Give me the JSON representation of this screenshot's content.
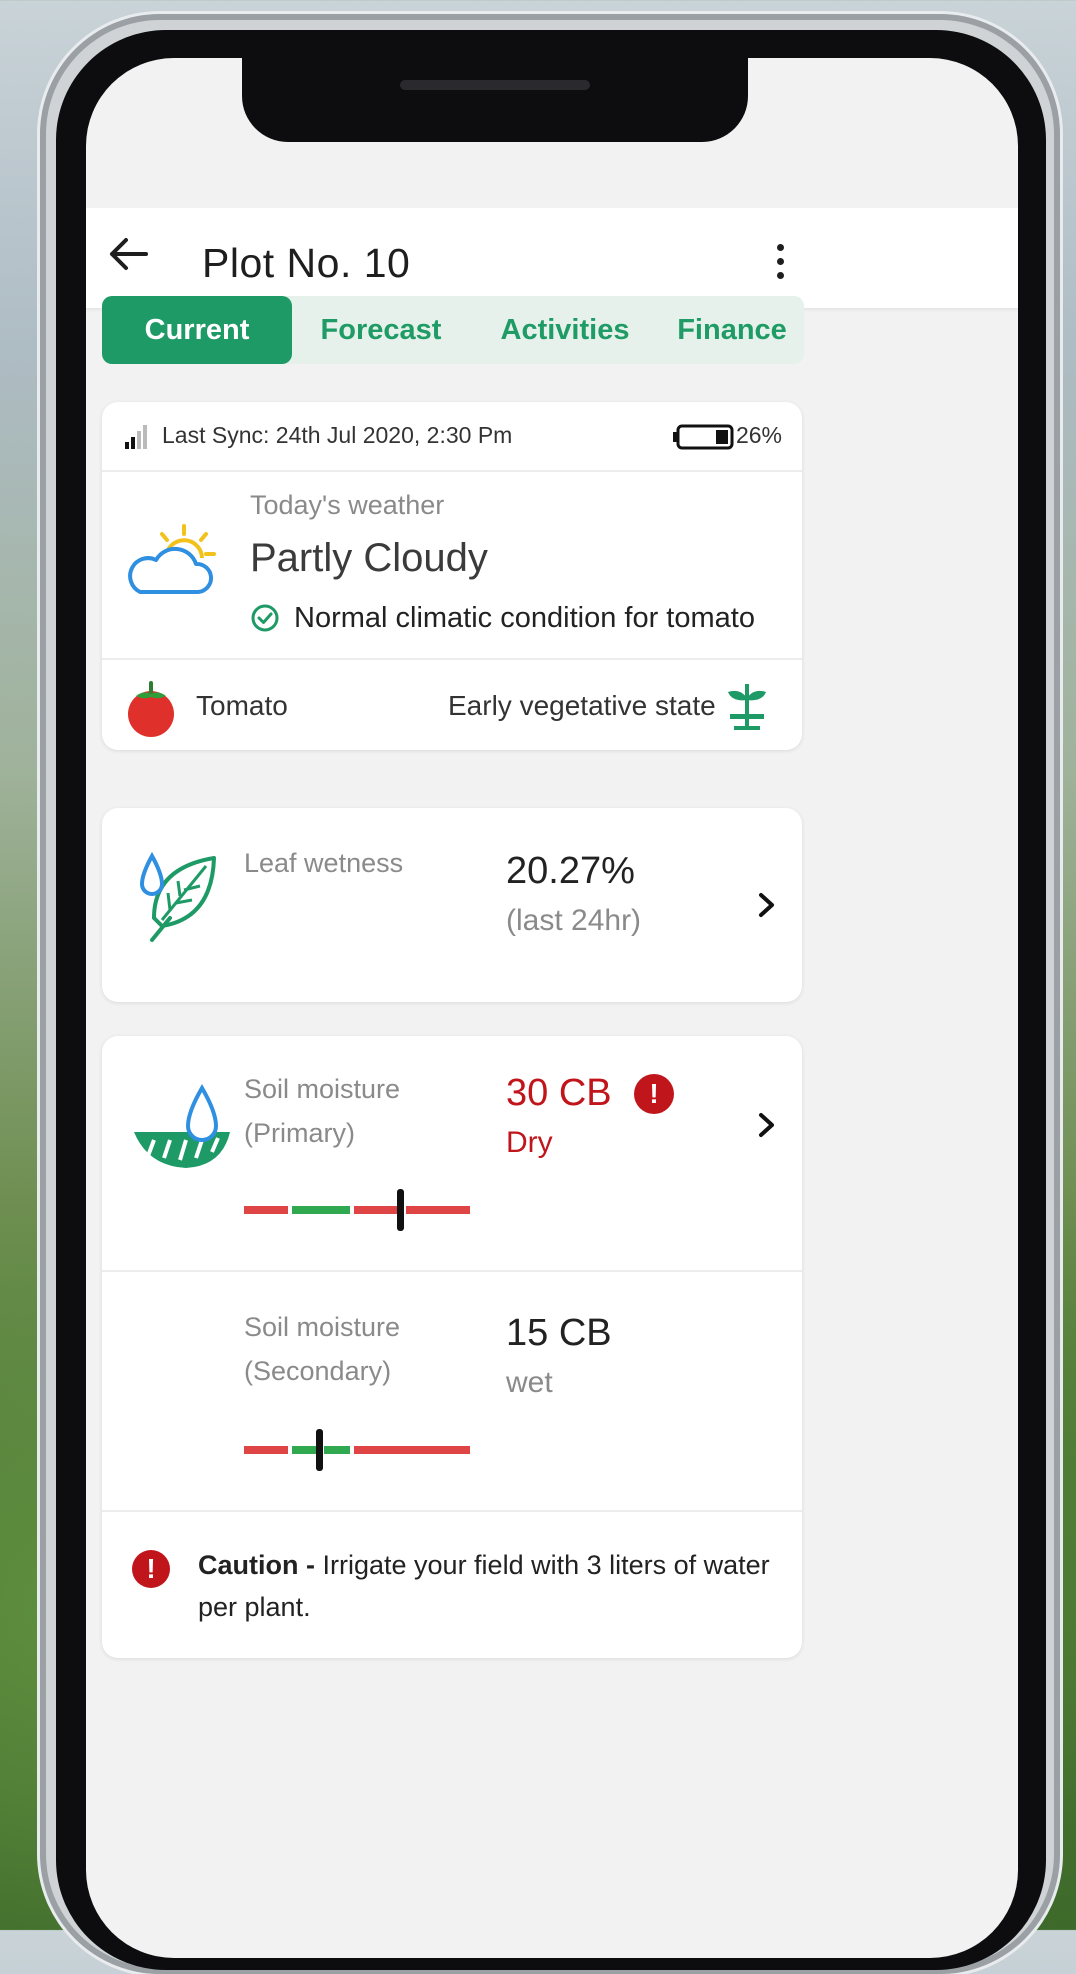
{
  "header": {
    "title": "Plot No. 10"
  },
  "tabs": [
    {
      "label": "Current",
      "active": true
    },
    {
      "label": "Forecast",
      "active": false
    },
    {
      "label": "Activities",
      "active": false
    },
    {
      "label": "Finance",
      "active": false
    }
  ],
  "status": {
    "last_sync": "Last Sync: 24th Jul 2020, 2:30 Pm",
    "battery": "26%"
  },
  "weather": {
    "label": "Today's weather",
    "condition": "Partly Cloudy",
    "note": "Normal climatic condition for tomato"
  },
  "crop": {
    "name": "Tomato",
    "stage": "Early vegetative state"
  },
  "leaf_wetness": {
    "label": "Leaf wetness",
    "value": "20.27%",
    "period": "(last 24hr)"
  },
  "soil_primary": {
    "label_line1": "Soil moisture",
    "label_line2": "(Primary)",
    "value": "30 CB",
    "status": "Dry"
  },
  "soil_secondary": {
    "label_line1": "Soil moisture",
    "label_line2": "(Secondary)",
    "value": "15 CB",
    "status": "wet"
  },
  "caution": {
    "title": "Caution -",
    "message": "Irrigate your field with 3 liters of water per plant."
  },
  "colors": {
    "accent": "#1e9a66",
    "alert": "#c1151c",
    "gauge_red": "#e04545",
    "gauge_green": "#2fa84f"
  }
}
